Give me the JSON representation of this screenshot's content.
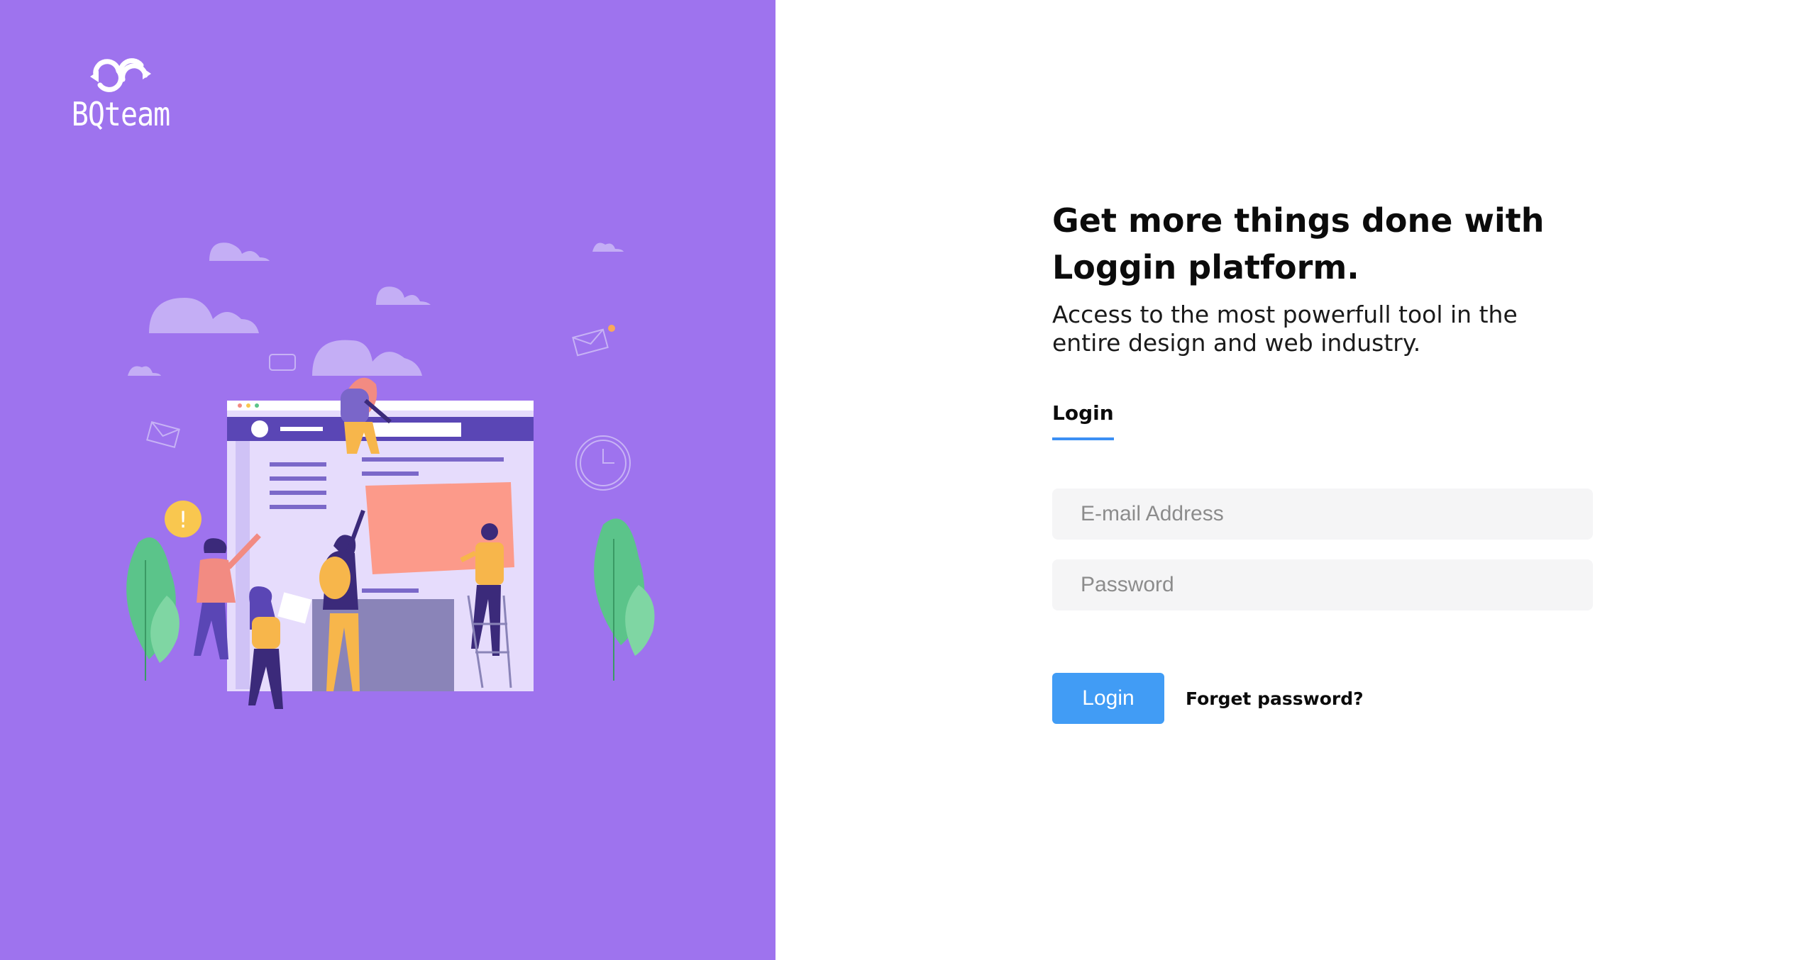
{
  "brand": {
    "name": "BQteam",
    "icon": "linked-arrows-logo-icon"
  },
  "illustration": {
    "icon": "team-collaboration-illustration"
  },
  "main": {
    "headline": "Get more things done with Loggin platform.",
    "subheadline": "Access to the most powerfull tool in the entire design and web industry."
  },
  "tabs": [
    {
      "label": "Login",
      "active": true
    }
  ],
  "form": {
    "email_placeholder": "E-mail Address",
    "email_value": "",
    "password_placeholder": "Password",
    "password_value": "",
    "login_label": "Login",
    "forgot_label": "Forget password?"
  },
  "colors": {
    "left_panel": "#9e73ee",
    "accent": "#419cf5",
    "tab_underline": "#3b8ff4",
    "field_bg": "#f5f5f6"
  }
}
